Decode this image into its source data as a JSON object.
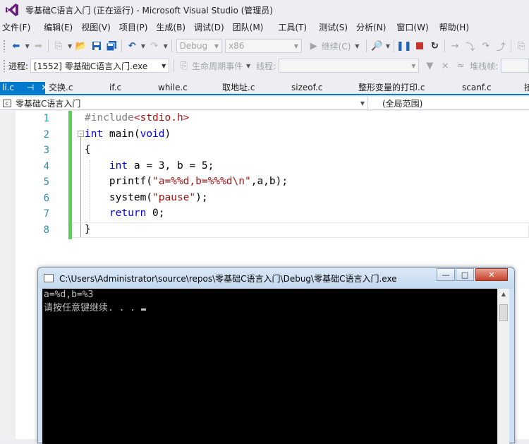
{
  "window": {
    "title": "零基础C语言入门 (正在运行) - Microsoft Visual Studio (管理员)"
  },
  "menu": [
    "文件(F)",
    "编辑(E)",
    "视图(V)",
    "项目(P)",
    "生成(B)",
    "调试(D)",
    "团队(M)",
    "工具(T)",
    "测试(S)",
    "分析(N)",
    "窗口(W)",
    "帮助(H)"
  ],
  "toolbar1": {
    "config": "Debug",
    "platform": "x86",
    "continue_label": "继续(C)"
  },
  "toolbar2": {
    "process_label": "进程:",
    "process_value": "[1552] 零基础C语言入门.exe",
    "lifecycle_label": "生命周期事件",
    "thread_label": "线程:",
    "stackframe_label": "堆栈帧:"
  },
  "tabs": [
    "li.c",
    "交换.c",
    "if.c",
    "while.c",
    "取地址.c",
    "sizeof.c",
    "整形变量的打印.c",
    "scanf.c",
    "接"
  ],
  "navbar": {
    "scope_left": "零基础C语言入门",
    "scope_right": "(全局范围)"
  },
  "editor": {
    "line_numbers": [
      "1",
      "2",
      "3",
      "4",
      "5",
      "6",
      "7",
      "8"
    ],
    "lines": [
      "#include<stdio.h>",
      "int main(void)",
      "{",
      "    int a = 3, b = 5;",
      "    printf(\"a=%%d,b=%%%d\\n\",a,b);",
      "    system(\"pause\");",
      "    return 0;",
      "}"
    ]
  },
  "console": {
    "title": "C:\\Users\\Administrator\\source\\repos\\零基础C语言入门\\Debug\\零基础C语言入门.exe",
    "output": [
      "a=%d,b=%3",
      "请按任意键继续. . . "
    ]
  },
  "colors": {
    "accent": "#007acc",
    "keyword": "#0000ff",
    "string": "#a31515",
    "preprocessor": "#808080",
    "line_number": "#2b91af",
    "change_bar": "#57d05b"
  },
  "icons": [
    "vs-logo-icon",
    "back-icon",
    "forward-icon",
    "new-project-icon",
    "open-file-icon",
    "save-icon",
    "save-all-icon",
    "undo-icon",
    "redo-icon",
    "continue-icon",
    "find-icon",
    "pause-icon",
    "stop-icon",
    "restart-icon",
    "step-over-icon",
    "step-into-icon",
    "step-out-icon"
  ]
}
